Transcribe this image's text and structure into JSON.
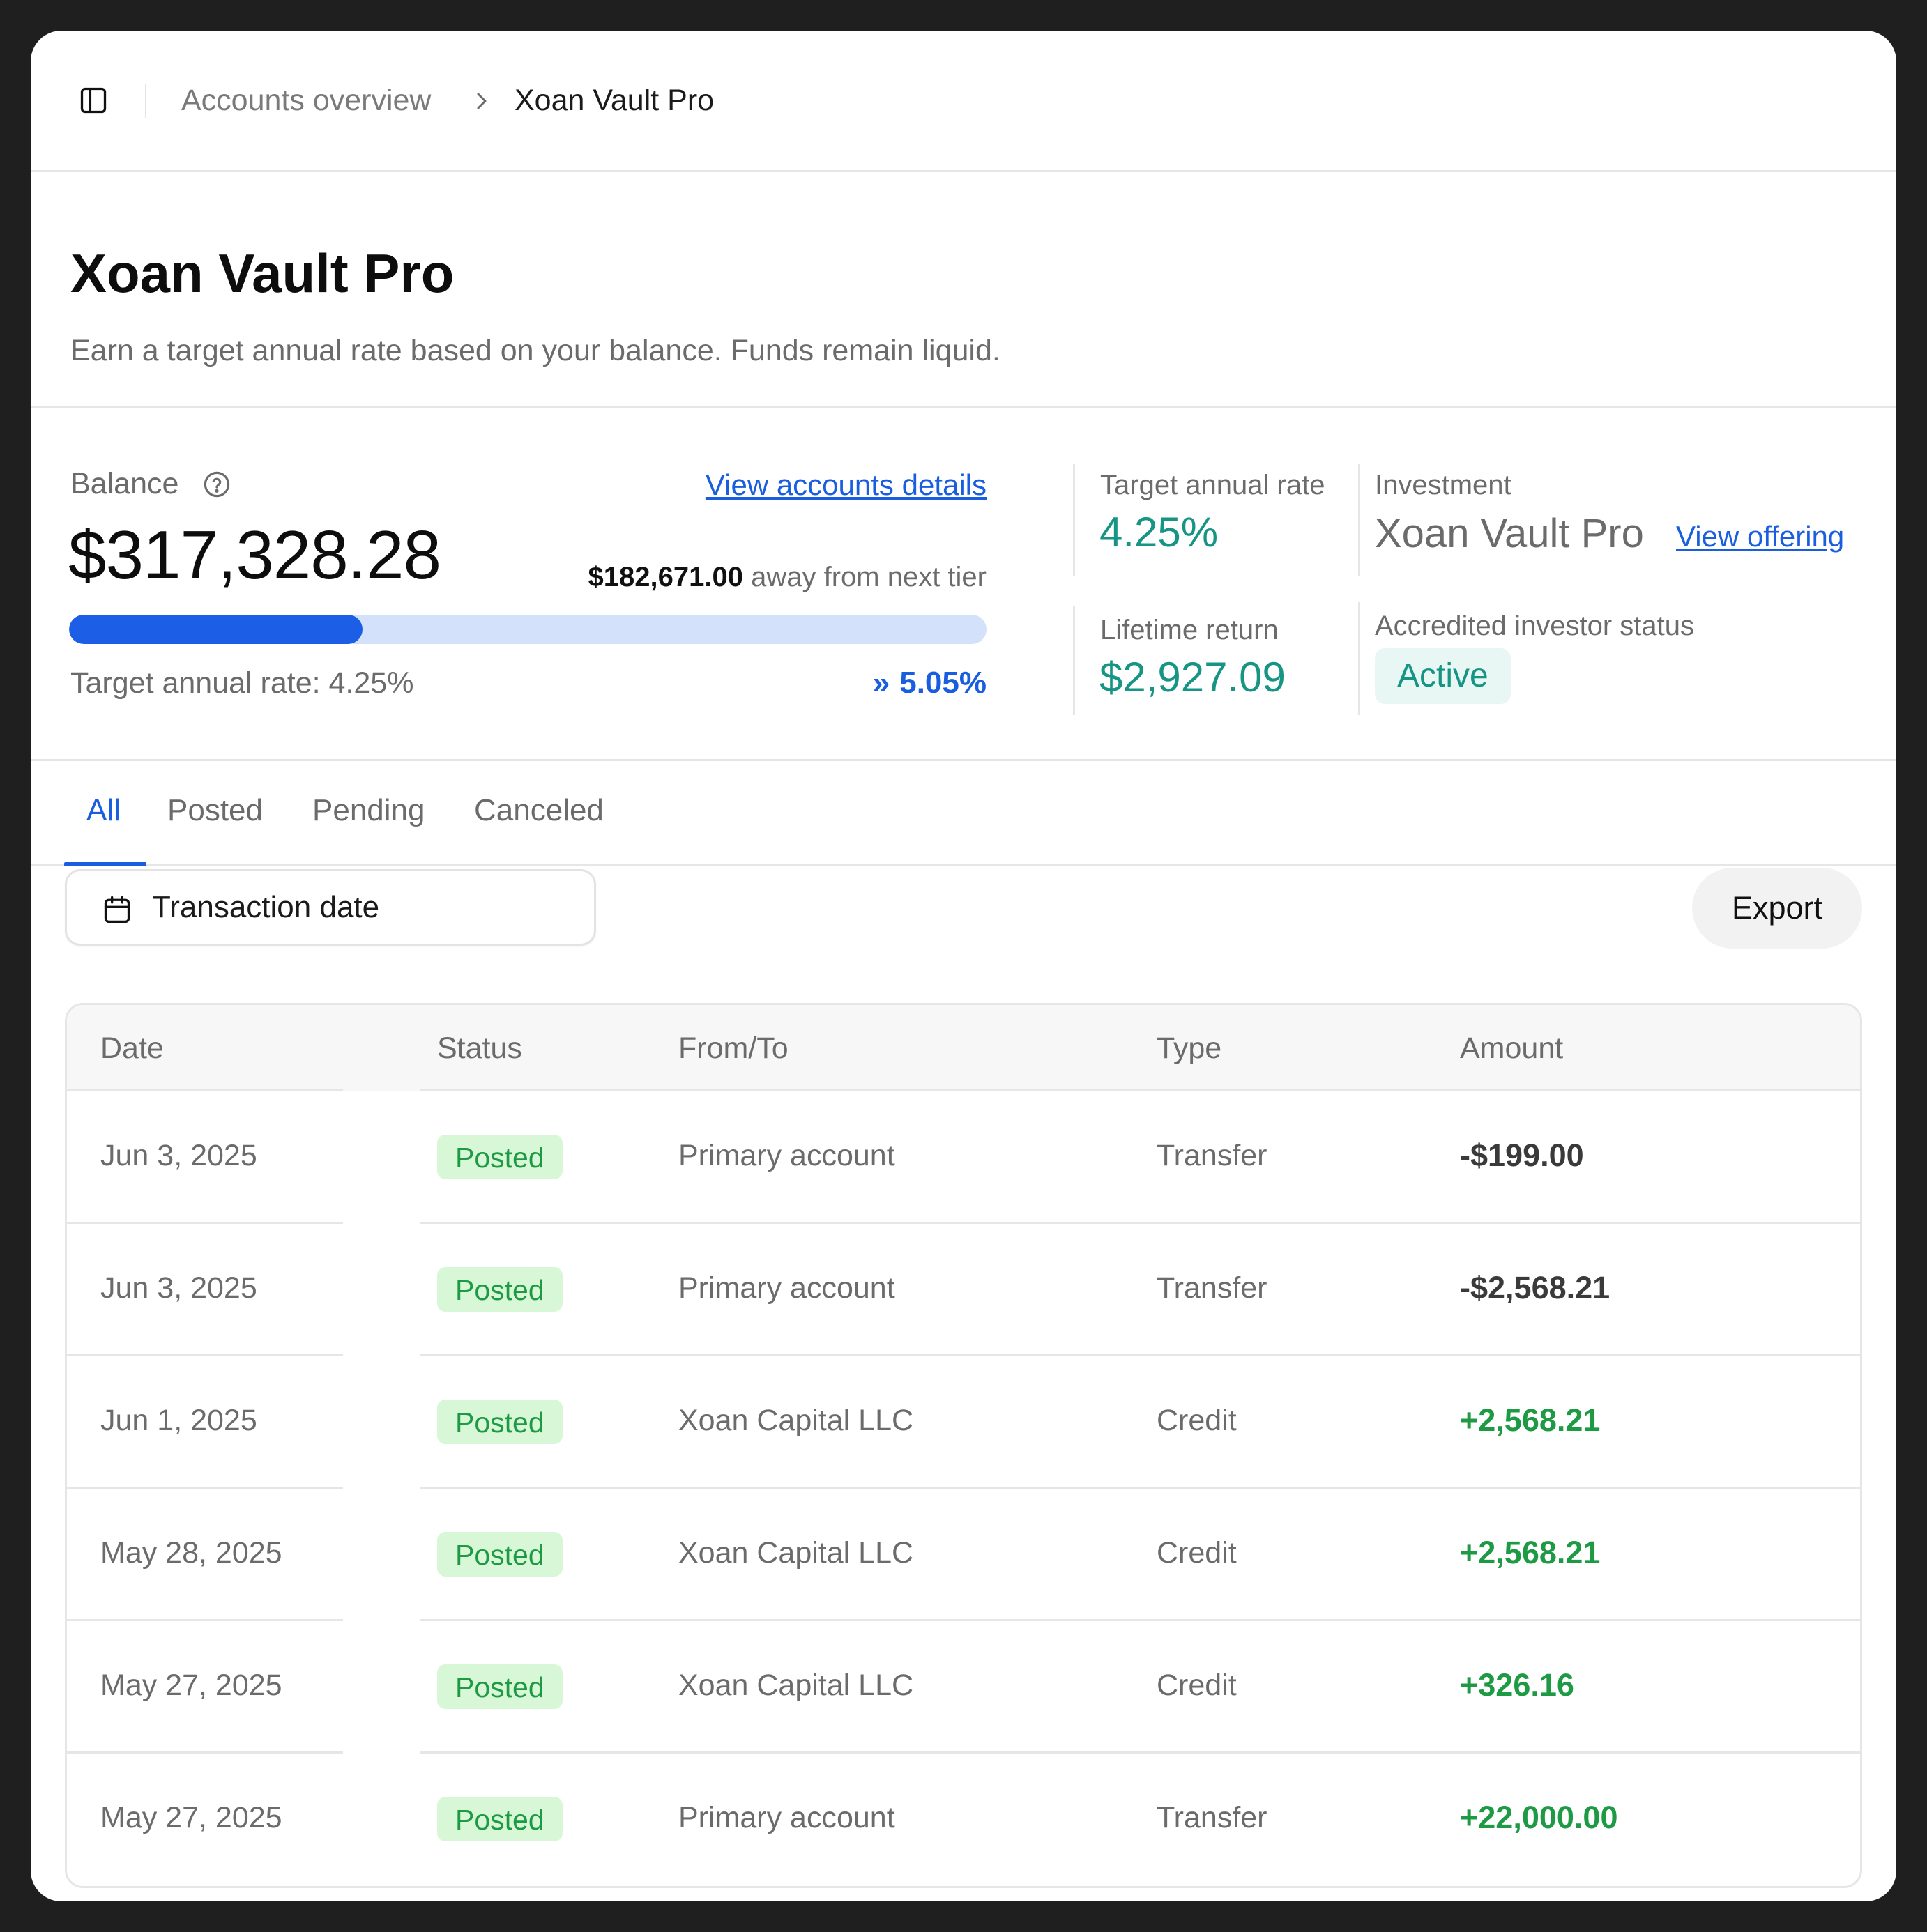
{
  "breadcrumb": {
    "parent": "Accounts overview",
    "current": "Xoan Vault Pro"
  },
  "header": {
    "title": "Xoan Vault Pro",
    "subtitle": "Earn a target annual rate based on your balance. Funds remain liquid."
  },
  "balance": {
    "label": "Balance",
    "amount": "$317,328.28",
    "details_link": "View accounts details",
    "away_amount": "$182,671.00",
    "away_text": " away from next tier",
    "progress_fraction": 0.32,
    "rate_text": "Target annual rate: 4.25%",
    "next_rate": "5.05%"
  },
  "metrics": {
    "target_rate_label": "Target annual rate",
    "target_rate_value": "4.25%",
    "lifetime_label": "Lifetime return",
    "lifetime_value": "$2,927.09",
    "investment_label": "Investment",
    "investment_name": "Xoan Vault Pro",
    "view_offering": "View offering",
    "accredited_label": "Accredited investor status",
    "accredited_value": "Active"
  },
  "tabs": [
    "All",
    "Posted",
    "Pending",
    "Canceled"
  ],
  "active_tab": "All",
  "toolbar": {
    "date_filter": "Transaction date",
    "export": "Export"
  },
  "table": {
    "headers": {
      "date": "Date",
      "status": "Status",
      "from_to": "From/To",
      "type": "Type",
      "amount": "Amount"
    },
    "rows": [
      {
        "date": "Jun 3, 2025",
        "status": "Posted",
        "from_to": "Primary account",
        "type": "Transfer",
        "amount": "-$199.00"
      },
      {
        "date": "Jun 3, 2025",
        "status": "Posted",
        "from_to": "Primary account",
        "type": "Transfer",
        "amount": "-$2,568.21"
      },
      {
        "date": "Jun 1, 2025",
        "status": "Posted",
        "from_to": "Xoan Capital LLC",
        "type": "Credit",
        "amount": "+2,568.21"
      },
      {
        "date": "May 28, 2025",
        "status": "Posted",
        "from_to": "Xoan Capital LLC",
        "type": "Credit",
        "amount": "+2,568.21"
      },
      {
        "date": "May 27, 2025",
        "status": "Posted",
        "from_to": "Xoan Capital LLC",
        "type": "Credit",
        "amount": "+326.16"
      },
      {
        "date": "May 27, 2025",
        "status": "Posted",
        "from_to": "Primary account",
        "type": "Transfer",
        "amount": "+22,000.00"
      }
    ]
  },
  "colors": {
    "accent": "#1a5ee0",
    "teal": "#169584",
    "positive": "#1d9a43",
    "badge_bg": "#d7f7d6"
  },
  "icons": {
    "sidebar": "sidebar-toggle-icon",
    "help": "help-circle-icon",
    "chevron": "chevron-right-icon",
    "calendar": "calendar-icon",
    "next_tier": "double-chevron-right-icon"
  }
}
